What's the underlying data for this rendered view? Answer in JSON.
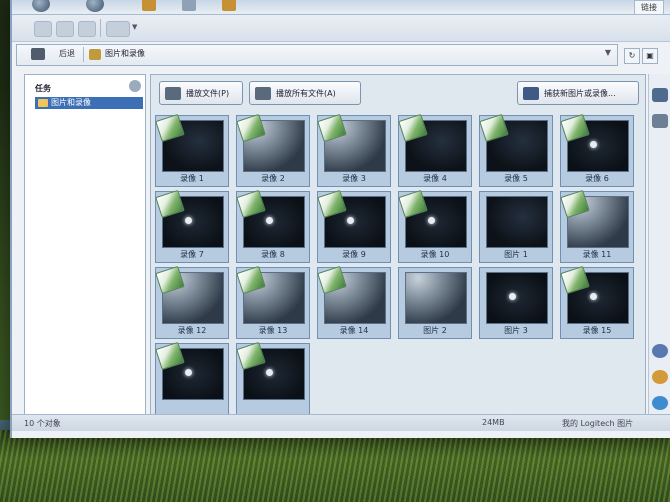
{
  "window": {
    "top_right": "链接"
  },
  "address": {
    "back_label": "后退",
    "path": "图片和录像"
  },
  "nav": {
    "header": "任务",
    "selected_item": "图片和录像"
  },
  "toolbar": {
    "play_file_label": "播放文件(P)",
    "play_all_label": "播放所有文件(A)",
    "capture_label": "捕获新图片或录像..."
  },
  "items": [
    {
      "label": "录像 1",
      "kind": "video",
      "shade": "dark"
    },
    {
      "label": "录像 2",
      "kind": "video",
      "shade": "moon"
    },
    {
      "label": "录像 3",
      "kind": "video",
      "shade": "moon"
    },
    {
      "label": "录像 4",
      "kind": "video",
      "shade": "dark"
    },
    {
      "label": "录像 5",
      "kind": "video",
      "shade": "dark"
    },
    {
      "label": "录像 6",
      "kind": "video",
      "shade": "dot"
    },
    {
      "label": "录像 7",
      "kind": "video",
      "shade": "dot"
    },
    {
      "label": "录像 8",
      "kind": "video",
      "shade": "dot"
    },
    {
      "label": "录像 9",
      "kind": "video",
      "shade": "dot"
    },
    {
      "label": "录像 10",
      "kind": "video",
      "shade": "dot"
    },
    {
      "label": "图片 1",
      "kind": "picture",
      "shade": "dark"
    },
    {
      "label": "录像 11",
      "kind": "video",
      "shade": "moon"
    },
    {
      "label": "录像 12",
      "kind": "video",
      "shade": "moon"
    },
    {
      "label": "录像 13",
      "kind": "video",
      "shade": "moon"
    },
    {
      "label": "录像 14",
      "kind": "video",
      "shade": "moon"
    },
    {
      "label": "图片 2",
      "kind": "picture",
      "shade": "moon"
    },
    {
      "label": "图片 3",
      "kind": "picture",
      "shade": "dot"
    },
    {
      "label": "录像 15",
      "kind": "video",
      "shade": "dot"
    },
    {
      "label": "",
      "kind": "video",
      "shade": "dot"
    },
    {
      "label": "",
      "kind": "video",
      "shade": "dot"
    }
  ],
  "status": {
    "left": "10 个对象",
    "middle": "24MB",
    "right": "我的 Logitech 图片"
  },
  "colors": {
    "selection": "#3d6fb7",
    "thumb_bg": "#b7cbe0",
    "window_bg": "#eef2f6"
  }
}
